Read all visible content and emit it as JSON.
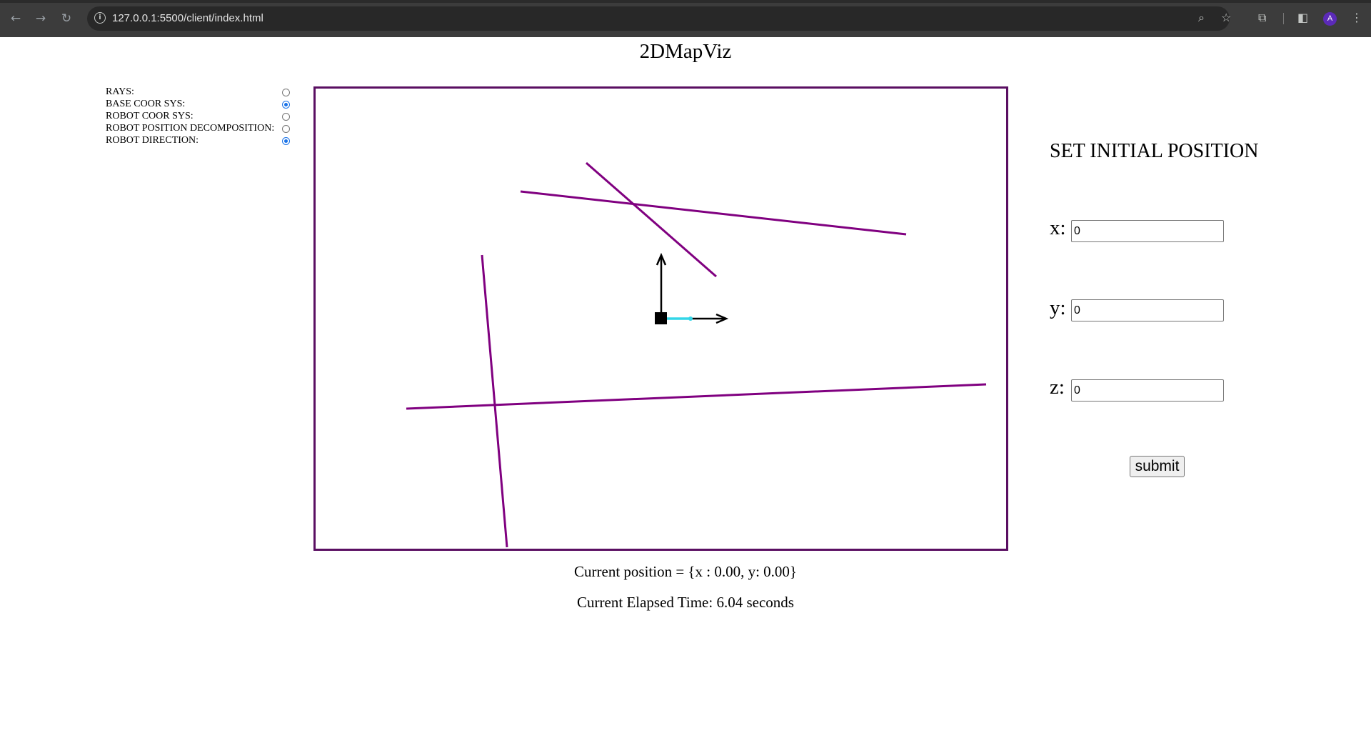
{
  "browser": {
    "url": "127.0.0.1:5500/client/index.html",
    "avatar_initial": "A"
  },
  "page": {
    "title": "2DMapViz",
    "toggles": [
      {
        "label": "RAYS:",
        "checked": false
      },
      {
        "label": "BASE COOR SYS:",
        "checked": true
      },
      {
        "label": "ROBOT COOR SYS:",
        "checked": false
      },
      {
        "label": "ROBOT POSITION DECOMPOSITION:",
        "checked": false
      },
      {
        "label": "ROBOT DIRECTION:",
        "checked": true
      }
    ],
    "position_text": "Current position = {x : 0.00, y: 0.00}",
    "elapsed_text": "Current Elapsed Time: 6.04 seconds"
  },
  "form": {
    "title": "SET INITIAL POSITION",
    "fields": [
      {
        "label": "x:",
        "value": "0"
      },
      {
        "label": "y:",
        "value": "0"
      },
      {
        "label": "z:",
        "value": "0"
      }
    ],
    "submit_label": "submit"
  },
  "colors": {
    "wall": "#800080",
    "border": "#5a0f62",
    "axis": "#000000",
    "direction": "#33d6e8"
  }
}
